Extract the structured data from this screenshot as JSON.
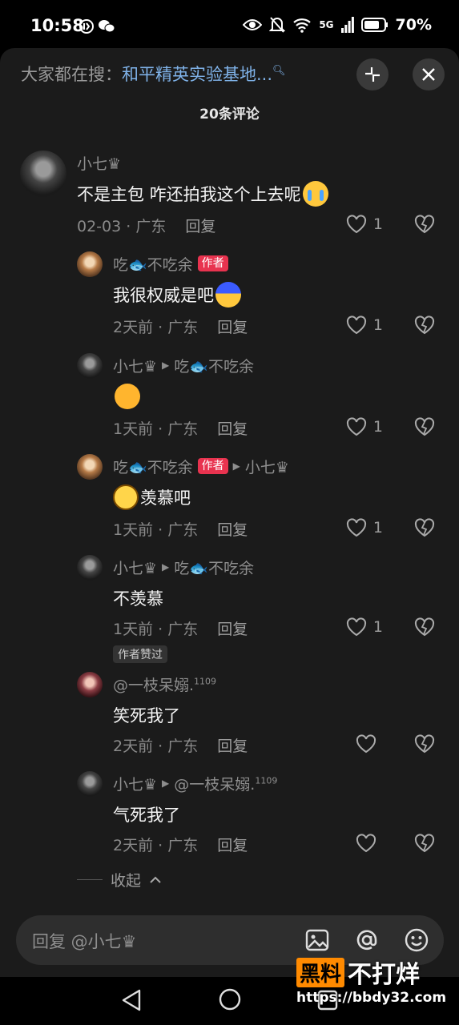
{
  "status": {
    "time": "10:58",
    "network": "5G",
    "battery": "70%"
  },
  "header": {
    "search_prefix": "大家都在搜：",
    "search_keyword": "和平精英实验基地...",
    "comment_count": "20条评论"
  },
  "comments": [
    {
      "user": "小七♛",
      "text": "不是主包 咋还拍我这个上去呢",
      "emoji": "loudly-crying-face",
      "date": "02-03",
      "location": "广东",
      "reply_label": "回复",
      "likes": "1"
    },
    {
      "user": "吃🐟不吃余",
      "badge": "作者",
      "text": "我很权威是吧",
      "emoji": "blue-hair-face",
      "date": "2天前",
      "location": "广东",
      "reply_label": "回复",
      "likes": "1"
    },
    {
      "user": "小七♛",
      "reply_to": "吃🐟不吃余",
      "text": "",
      "emoji": "crying-laughing-face",
      "date": "1天前",
      "location": "广东",
      "reply_label": "回复",
      "likes": "1"
    },
    {
      "user": "吃🐟不吃余",
      "badge": "作者",
      "reply_to": "小七♛",
      "text": "羡慕吧",
      "emoji": "smiling-face",
      "date": "1天前",
      "location": "广东",
      "reply_label": "回复",
      "likes": "1"
    },
    {
      "user": "小七♛",
      "reply_to": "吃🐟不吃余",
      "text": "不羡慕",
      "date": "1天前",
      "location": "广东",
      "reply_label": "回复",
      "likes": "1",
      "tag": "作者赞过"
    },
    {
      "user": "@一枝呆嫋.",
      "user_sup": "1109",
      "text": "笑死我了",
      "date": "2天前",
      "location": "广东",
      "reply_label": "回复",
      "likes": ""
    },
    {
      "user": "小七♛",
      "reply_to": "@一枝呆嫋.",
      "reply_to_sup": "1109",
      "text": "气死我了",
      "date": "2天前",
      "location": "广东",
      "reply_label": "回复",
      "likes": ""
    }
  ],
  "collapse_label": "收起",
  "reply_bar": {
    "placeholder": "回复 @小七♛",
    "icons": [
      "image-icon",
      "at-icon",
      "emoji-icon"
    ]
  },
  "watermark": {
    "box_text": "黑料",
    "text": "不打烊",
    "url": "https://bbdy32.com"
  }
}
